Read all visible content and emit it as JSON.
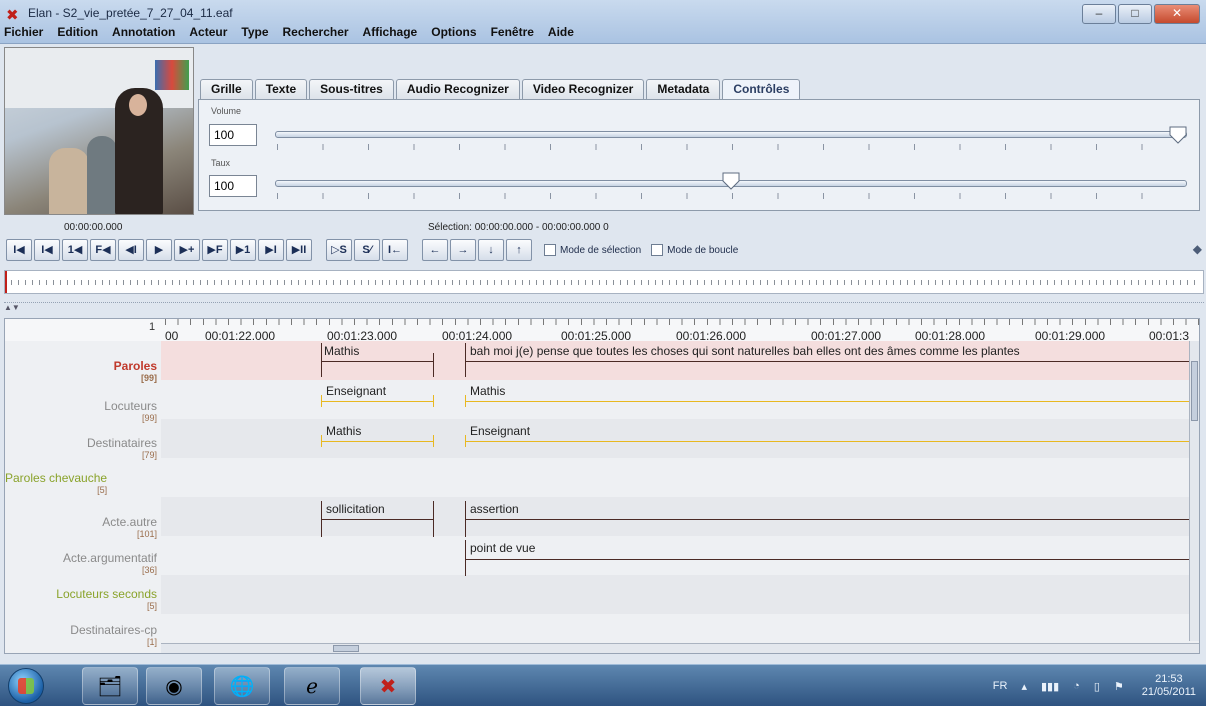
{
  "window": {
    "title": "Elan - S2_vie_pretée_7_27_04_11.eaf",
    "minimize": "–",
    "maximize": "□",
    "close": "✕"
  },
  "menu": [
    "Fichier",
    "Edition",
    "Annotation",
    "Acteur",
    "Type",
    "Rechercher",
    "Affichage",
    "Options",
    "Fenêtre",
    "Aide"
  ],
  "tabs": [
    "Grille",
    "Texte",
    "Sous-titres",
    "Audio Recognizer",
    "Video Recognizer",
    "Metadata",
    "Contrôles"
  ],
  "active_tab": "Contrôles",
  "controls": {
    "volume": {
      "label": "Volume",
      "value": "100",
      "level": 1.0
    },
    "rate": {
      "label": "Taux",
      "value": "100",
      "level": 0.5
    }
  },
  "media_time": "00:00:00.000",
  "selection_text": "Sélection: 00:00:00.000 - 00:00:00.000  0",
  "toolbar": {
    "buttons": [
      "I◀",
      "I◀",
      "1◀",
      "F◀",
      "◀I",
      "▶",
      "▶+",
      "▶F",
      "▶1",
      "▶I",
      "▶II"
    ],
    "sel_buttons": [
      "▷S",
      "S⁄",
      "I←"
    ],
    "arrows": [
      "←",
      "→",
      "↓",
      "↑"
    ],
    "mode_selection": "Mode de sélection",
    "mode_boucle": "Mode de boucle"
  },
  "ruler": {
    "playhead_number": "1",
    "labels": [
      "00",
      "00:01:22.000",
      "00:01:23.000",
      "00:01:24.000",
      "00:01:25.000",
      "00:01:26.000",
      "00:01:27.000",
      "00:01:28.000",
      "00:01:29.000",
      "00:01:3"
    ]
  },
  "tiers": [
    {
      "name": "Paroles",
      "count": "[99]",
      "color": "#c0392b",
      "active": true
    },
    {
      "name": "Locuteurs",
      "count": "[99]",
      "color": "#8a8a8a"
    },
    {
      "name": "Destinataires",
      "count": "[79]",
      "color": "#8a8a8a"
    },
    {
      "name": "Paroles chevauche",
      "count": "[5]",
      "color": "#8aa32b"
    },
    {
      "name": "Acte.autre",
      "count": "[101]",
      "color": "#8a8a8a"
    },
    {
      "name": "Acte.argumentatif",
      "count": "[36]",
      "color": "#8a8a8a"
    },
    {
      "name": "Locuteurs seconds",
      "count": "[5]",
      "color": "#8aa32b"
    },
    {
      "name": "Destinataires-cp",
      "count": "[1]",
      "color": "#8a8a8a"
    }
  ],
  "annotations": {
    "paroles": [
      "Mathis",
      "bah moi j(e) pense que toutes les choses qui sont naturelles bah elles ont des âmes comme les plantes"
    ],
    "locuteurs": [
      "Enseignant",
      "Mathis"
    ],
    "destinataires": [
      "Mathis",
      "Enseignant"
    ],
    "acte_autre": [
      "sollicitation",
      "assertion"
    ],
    "acte_argumentatif": [
      "point de vue"
    ]
  },
  "colors": {
    "speech_line": "#5a2a24",
    "speaker_line": "#e8b820",
    "accent_red": "#c0201a"
  },
  "taskbar": {
    "lang": "FR",
    "time": "21:53",
    "date": "21/05/2011",
    "apps": [
      "explorer-icon",
      "media-player-icon",
      "firefox-icon",
      "internet-explorer-icon",
      "elan-icon"
    ]
  }
}
